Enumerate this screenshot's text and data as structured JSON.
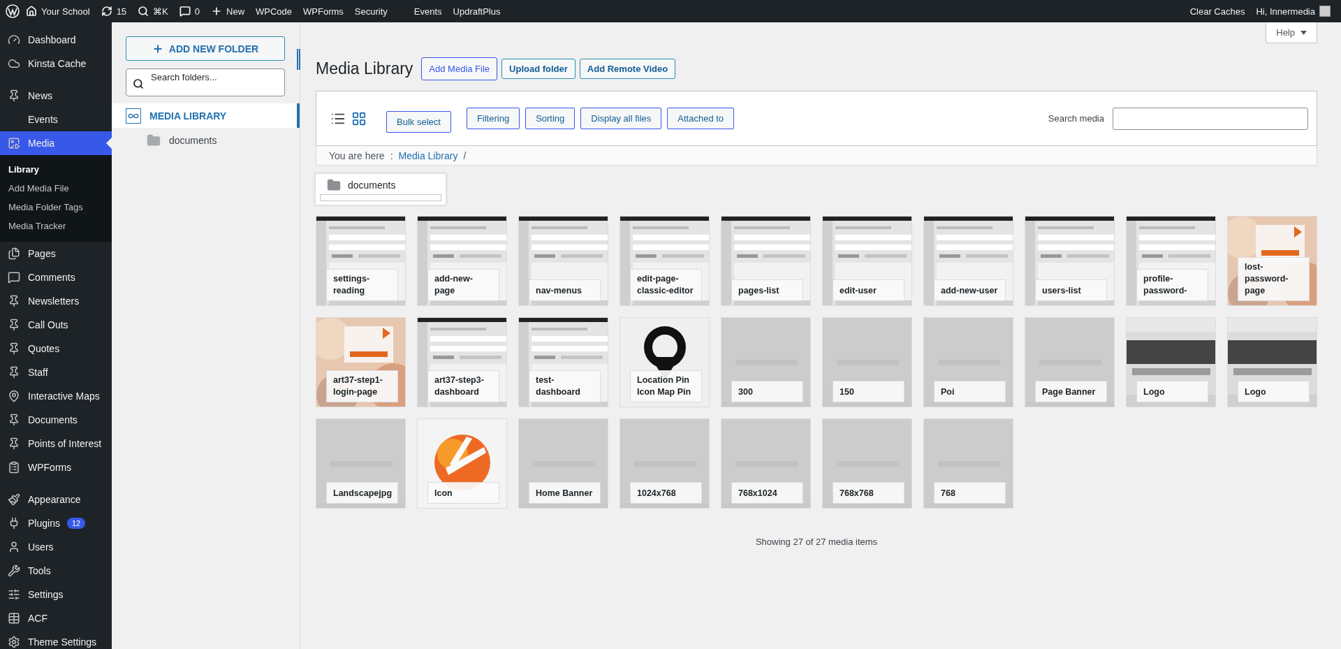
{
  "admin_bar": {
    "left": [
      {
        "label": "Your School"
      },
      {
        "label": "15"
      },
      {
        "label": "⌘K"
      },
      {
        "label": "0"
      },
      {
        "label": "New"
      },
      {
        "label": "WPCode"
      },
      {
        "label": "WPForms"
      },
      {
        "label": "Security"
      },
      {
        "label": "Events"
      },
      {
        "label": "UpdraftPlus"
      }
    ],
    "right": [
      {
        "label": "Clear Caches"
      },
      {
        "label": "Hi, Innermedia"
      }
    ]
  },
  "sidebar": {
    "items": [
      {
        "label": "Dashboard",
        "selected": false
      },
      {
        "label": "Kinsta Cache",
        "selected": false
      },
      {
        "label": "News",
        "selected": false
      },
      {
        "label": "Events",
        "selected": false
      },
      {
        "label": "Media",
        "selected": true,
        "children": [
          {
            "label": "Library",
            "selected": true
          },
          {
            "label": "Add Media File",
            "selected": false
          },
          {
            "label": "Media Folder Tags",
            "selected": false
          },
          {
            "label": "Media Tracker",
            "selected": false
          }
        ]
      },
      {
        "label": "Pages",
        "selected": false
      },
      {
        "label": "Comments",
        "selected": false
      },
      {
        "label": "Newsletters",
        "selected": false
      },
      {
        "label": "Call Outs",
        "selected": false
      },
      {
        "label": "Quotes",
        "selected": false
      },
      {
        "label": "Staff",
        "selected": false
      },
      {
        "label": "Interactive Maps",
        "selected": false
      },
      {
        "label": "Documents",
        "selected": false
      },
      {
        "label": "Points of Interest",
        "selected": false
      },
      {
        "label": "WPForms",
        "selected": false
      },
      {
        "label": "Appearance",
        "selected": false
      },
      {
        "label": "Plugins",
        "selected": false,
        "badge": "12"
      },
      {
        "label": "Users",
        "selected": false
      },
      {
        "label": "Tools",
        "selected": false
      },
      {
        "label": "Settings",
        "selected": false
      },
      {
        "label": "ACF",
        "selected": false
      },
      {
        "label": "Theme Settings",
        "selected": false
      }
    ]
  },
  "folder_panel": {
    "add_button": "ADD NEW FOLDER",
    "search": {
      "placeholder": "Search folders..."
    },
    "tree": [
      {
        "label": "MEDIA LIBRARY",
        "selected": true,
        "children": [
          {
            "label": "documents",
            "selected": false
          }
        ]
      }
    ]
  },
  "help_button": "Help",
  "page": {
    "title": "Media Library",
    "buttons": [
      {
        "label": "Add Media File",
        "kind": "light"
      },
      {
        "label": "Upload folder",
        "kind": "bold"
      },
      {
        "label": "Add Remote Video",
        "kind": "bold"
      }
    ]
  },
  "toolbar": {
    "view_modes": [
      {
        "kind": "list",
        "selected": false
      },
      {
        "kind": "grid",
        "selected": true
      }
    ],
    "buttons": [
      {
        "label": "Bulk select",
        "kind": "select"
      },
      {
        "label": "Filtering",
        "kind": "filter"
      },
      {
        "label": "Sorting",
        "kind": "filter"
      },
      {
        "label": "Display all files",
        "kind": "filter"
      },
      {
        "label": "Attached to",
        "kind": "filter"
      }
    ],
    "search_label": "Search media"
  },
  "breadcrumb": {
    "label": "You are here",
    "separator": ":",
    "path": [
      {
        "label": "Media Library",
        "end": "/"
      }
    ]
  },
  "folders": [
    {
      "label": "documents"
    }
  ],
  "media": [
    {
      "label": "settings-reading",
      "kind": "screenshot"
    },
    {
      "label": "add-new-page",
      "kind": "screenshot"
    },
    {
      "label": "nav-menus",
      "kind": "screenshot"
    },
    {
      "label": "edit-page-classic-editor",
      "kind": "screenshot"
    },
    {
      "label": "pages-list",
      "kind": "screenshot"
    },
    {
      "label": "edit-user",
      "kind": "screenshot"
    },
    {
      "label": "add-new-user",
      "kind": "screenshot"
    },
    {
      "label": "users-list",
      "kind": "screenshot"
    },
    {
      "label": "profile-password-",
      "kind": "screenshot"
    },
    {
      "label": "lost-password-page"
    },
    {
      "label": "art37-step1-login-page"
    },
    {
      "label": "art37-step3-dashboard",
      "kind": "screenshot"
    },
    {
      "label": "test-dashboard",
      "kind": "screenshot"
    },
    {
      "label": "Location Pin Icon Map Pin",
      "kind": "pin"
    },
    {
      "label": "300",
      "kind": "placeholder"
    },
    {
      "label": "150",
      "kind": "placeholder"
    },
    {
      "label": "Poi",
      "kind": "placeholder"
    },
    {
      "label": "Page Banner",
      "kind": "placeholder"
    },
    {
      "label": "Logo",
      "kind": "logo"
    },
    {
      "label": "Logo",
      "kind": "logo"
    },
    {
      "label": "Landscapejpg",
      "kind": "placeholder"
    },
    {
      "label": "Icon",
      "kind": "icon"
    },
    {
      "label": "Home Banner",
      "kind": "placeholder"
    },
    {
      "label": "1024x768",
      "kind": "placeholder"
    },
    {
      "label": "768x1024",
      "kind": "placeholder"
    },
    {
      "label": "768x768",
      "kind": "placeholder"
    },
    {
      "label": "768",
      "kind": "placeholder"
    }
  ],
  "footer": "Showing 27 of 27 media items"
}
